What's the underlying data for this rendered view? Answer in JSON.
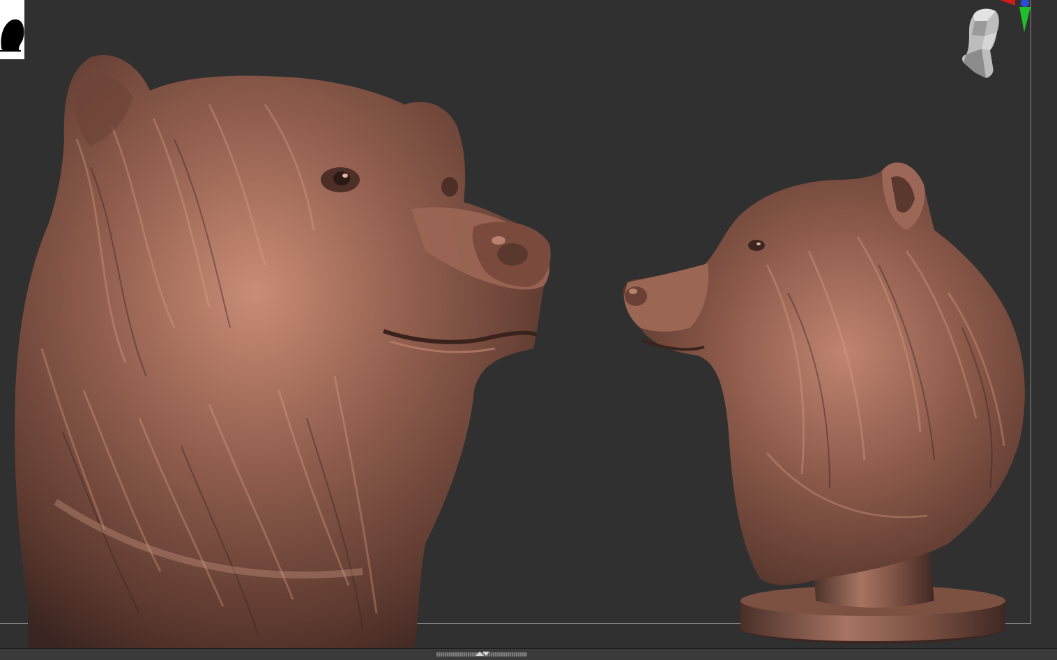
{
  "app": {
    "viewport_bg": "#303030",
    "material_color": "#8a5a4c",
    "highlight_color": "#d9a38d"
  },
  "icons": {
    "thumbnail": "model-thumbnail-icon",
    "gizmo": "navigation-head-gizmo-icon",
    "splitter": "panel-splitter-icon"
  }
}
